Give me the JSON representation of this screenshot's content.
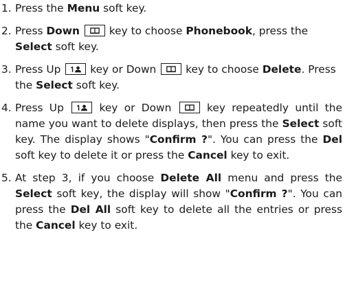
{
  "steps": [
    {
      "number": "1.",
      "parts": [
        {
          "t": "Press the "
        },
        {
          "b": "Menu"
        },
        {
          "t": " soft key."
        }
      ]
    },
    {
      "number": "2.",
      "parts": [
        {
          "t": "Press "
        },
        {
          "b": "Down"
        },
        {
          "t": " "
        },
        {
          "icon": "book-icon"
        },
        {
          "t": " key to choose "
        },
        {
          "b": "Phonebook"
        },
        {
          "t": ", press the "
        },
        {
          "b": "Select"
        },
        {
          "t": " soft key."
        }
      ]
    },
    {
      "number": "3.",
      "parts": [
        {
          "t": "Press Up "
        },
        {
          "icon": "contact-icon"
        },
        {
          "t": " key or Down "
        },
        {
          "icon": "book-icon"
        },
        {
          "t": " key to choose "
        },
        {
          "b": "Delete"
        },
        {
          "t": ". Press the "
        },
        {
          "b": "Select"
        },
        {
          "t": " soft key."
        }
      ]
    },
    {
      "number": "4.",
      "parts": [
        {
          "t": "Press Up "
        },
        {
          "icon": "contact-icon"
        },
        {
          "t": " key or Down "
        },
        {
          "icon": "book-icon"
        },
        {
          "t": " key repeatedly until the name you want to delete displays, then press the "
        },
        {
          "b": "Select"
        },
        {
          "t": " soft key. The display shows \""
        },
        {
          "b": "Confirm ?"
        },
        {
          "t": "\". You can press the "
        },
        {
          "b": "Del"
        },
        {
          "t": " soft key to delete it or press the "
        },
        {
          "b": "Cancel"
        },
        {
          "t": " key to exit."
        }
      ]
    },
    {
      "number": "5.",
      "parts": [
        {
          "t": "At step 3, if you choose "
        },
        {
          "b": "Delete All"
        },
        {
          "t": " menu and press the "
        },
        {
          "b": "Select"
        },
        {
          "t": " soft key, the display will show \""
        },
        {
          "b": "Confirm ?"
        },
        {
          "t": "\". You can press the "
        },
        {
          "b": "Del All"
        },
        {
          "t": " soft key to delete all the entries or press the "
        },
        {
          "b": "Cancel"
        },
        {
          "t": " key to exit."
        }
      ]
    }
  ]
}
